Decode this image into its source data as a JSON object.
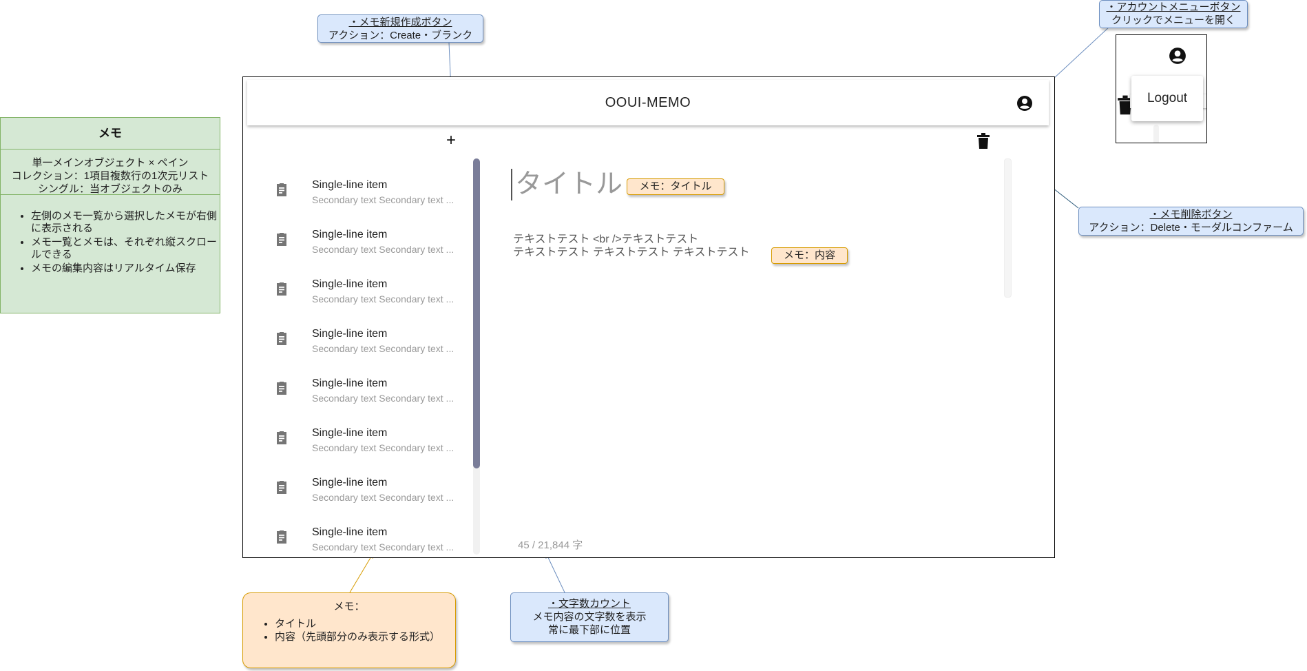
{
  "spec": {
    "title": "メモ",
    "lines": [
      "単一メインオブジェクト × ペイン",
      "コレクション：1項目複数行の1次元リスト",
      "シングル：当オブジェクトのみ"
    ],
    "bullets": [
      "左側のメモ一覧から選択したメモが右側に表示される",
      "メモ一覧とメモは、それぞれ縦スクロールできる",
      "メモの編集内容はリアルタイム保存"
    ]
  },
  "callouts": {
    "new_memo": {
      "title": "・メモ新規作成ボタン",
      "desc": "アクション：Create・ブランク"
    },
    "account_menu": {
      "title": "・アカウントメニューボタン",
      "desc": "クリックでメニューを開く"
    },
    "delete_memo": {
      "title": "・メモ削除ボタン",
      "desc": "アクション：Delete・モーダルコンファーム"
    },
    "char_count": {
      "title": "・文字数カウント",
      "desc1": "メモ内容の文字数を表示",
      "desc2": "常に最下部に位置"
    },
    "memo_item": {
      "title": "メモ：",
      "bullets": [
        "タイトル",
        "内容（先頭部分のみ表示する形式）"
      ]
    }
  },
  "tags": {
    "title_tag": "メモ：タイトル",
    "content_tag": "メモ：内容"
  },
  "app": {
    "title": "OOUI-MEMO",
    "add_label": "+",
    "list": [
      {
        "primary": "Single-line item",
        "secondary": "Secondary text Secondary text ..."
      },
      {
        "primary": "Single-line item",
        "secondary": "Secondary text Secondary text ..."
      },
      {
        "primary": "Single-line item",
        "secondary": "Secondary text Secondary text ..."
      },
      {
        "primary": "Single-line item",
        "secondary": "Secondary text Secondary text ..."
      },
      {
        "primary": "Single-line item",
        "secondary": "Secondary text Secondary text ..."
      },
      {
        "primary": "Single-line item",
        "secondary": "Secondary text Secondary text ..."
      },
      {
        "primary": "Single-line item",
        "secondary": "Secondary text Secondary text ..."
      },
      {
        "primary": "Single-line item",
        "secondary": "Secondary text Secondary text ..."
      }
    ],
    "memo": {
      "title_placeholder": "タイトル",
      "body_line1": "テキストテスト <br />テキストテスト",
      "body_line2": "テキストテスト テキストテスト テキストテスト"
    },
    "char_count": "45 / 21,844 字",
    "icons": {
      "list_item": "clipboard-icon",
      "delete": "trash-icon",
      "account": "account-circle-icon",
      "add": "plus-icon"
    }
  },
  "account_popup": {
    "menu_item": "Logout"
  },
  "colors": {
    "blue_callout": "#dae8fc",
    "orange_callout": "#ffe6cc",
    "green_spec": "#d5e8d4",
    "scroll_thumb": "#7a7d99"
  }
}
